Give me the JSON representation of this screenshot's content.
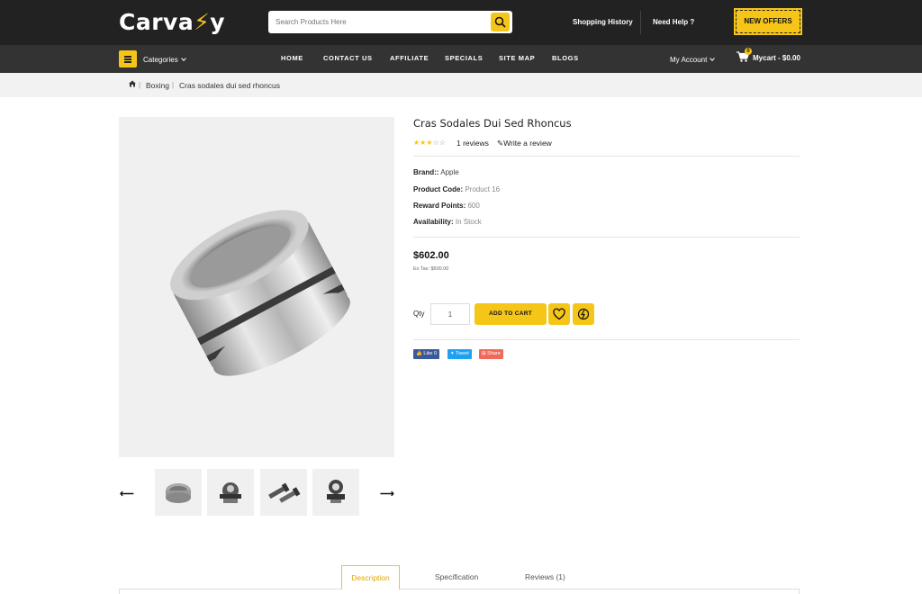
{
  "header": {
    "logo_text_a": "Carva",
    "logo_text_b": "y",
    "search_placeholder": "Search Products Here",
    "shopping_history": "Shopping History",
    "need_help": "Need Help ?",
    "offers": "NEW OFFERS"
  },
  "nav": {
    "categories": "Categories",
    "items": [
      "HOME",
      "CONTACT US",
      "AFFILIATE",
      "SPECIALS",
      "SITE MAP",
      "BLOGS"
    ],
    "my_account": "My Account",
    "cart_count": "0",
    "cart_label": "Mycart - $0.00"
  },
  "breadcrumb": [
    "Boxing",
    "Cras sodales dui sed rhoncus"
  ],
  "product": {
    "title": "Cras Sodales Dui Sed Rhoncus",
    "rating": 3,
    "rating_max": 5,
    "reviews": "1 reviews",
    "write_review": "Write a review",
    "brand_label": "Brand::",
    "brand_value": "Apple",
    "code_label": "Product Code:",
    "code_value": "Product 16",
    "points_label": "Reward Points:",
    "points_value": "600",
    "availability_label": "Availability:",
    "availability_value": "In Stock",
    "price": "$602.00",
    "ex_tax": "Ex Tax: $500.00",
    "qty_label": "Qty",
    "qty_value": "1",
    "add_to_cart": "ADD TO CART"
  },
  "social": {
    "like": "Like 0",
    "tweet": "Tweet",
    "share": "Share"
  },
  "tabs": [
    "Description",
    "Specification",
    "Reviews (1)"
  ],
  "colors": {
    "accent": "#f5c518",
    "topbar": "#222222",
    "navbar": "#333333"
  }
}
